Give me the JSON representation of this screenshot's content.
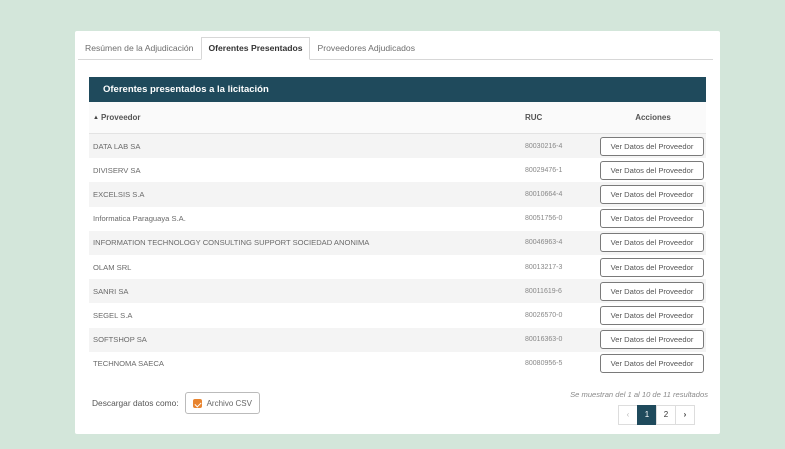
{
  "tabs": [
    {
      "label": "Resúmen de la Adjudicación",
      "active": false
    },
    {
      "label": "Oferentes Presentados",
      "active": true
    },
    {
      "label": "Proveedores Adjudicados",
      "active": false
    }
  ],
  "panel": {
    "title": "Oferentes presentados a la licitación"
  },
  "table": {
    "headers": {
      "proveedor": "Proveedor",
      "ruc": "RUC",
      "acciones": "Acciones"
    },
    "action_label": "Ver Datos del Proveedor",
    "rows": [
      {
        "proveedor": "DATA LAB SA",
        "ruc": "80030216-4"
      },
      {
        "proveedor": "DIVISERV SA",
        "ruc": "80029476-1"
      },
      {
        "proveedor": "EXCELSIS S.A",
        "ruc": "80010664-4"
      },
      {
        "proveedor": "Informatica Paraguaya S.A.",
        "ruc": "80051756-0"
      },
      {
        "proveedor": "INFORMATION TECHNOLOGY CONSULTING SUPPORT SOCIEDAD ANONIMA",
        "ruc": "80046963-4"
      },
      {
        "proveedor": "OLAM SRL",
        "ruc": "80013217-3"
      },
      {
        "proveedor": "SANRI SA",
        "ruc": "80011619-6"
      },
      {
        "proveedor": "SEGEL S.A",
        "ruc": "80026570-0"
      },
      {
        "proveedor": "SOFTSHOP SA",
        "ruc": "80016363-0"
      },
      {
        "proveedor": "TECHNOMA SAECA",
        "ruc": "80080956-5"
      }
    ]
  },
  "footer": {
    "download_label": "Descargar datos como:",
    "csv_label": "Archivo CSV",
    "results_info": "Se muestran del 1 al 10 de 11 resultados"
  },
  "pagination": {
    "prev": "‹",
    "pages": [
      "1",
      "2"
    ],
    "current": "1",
    "next": "›"
  },
  "colors": {
    "header_bar": "#1f4a5c",
    "background": "#d3e6da",
    "csv_icon": "#e8842f"
  }
}
